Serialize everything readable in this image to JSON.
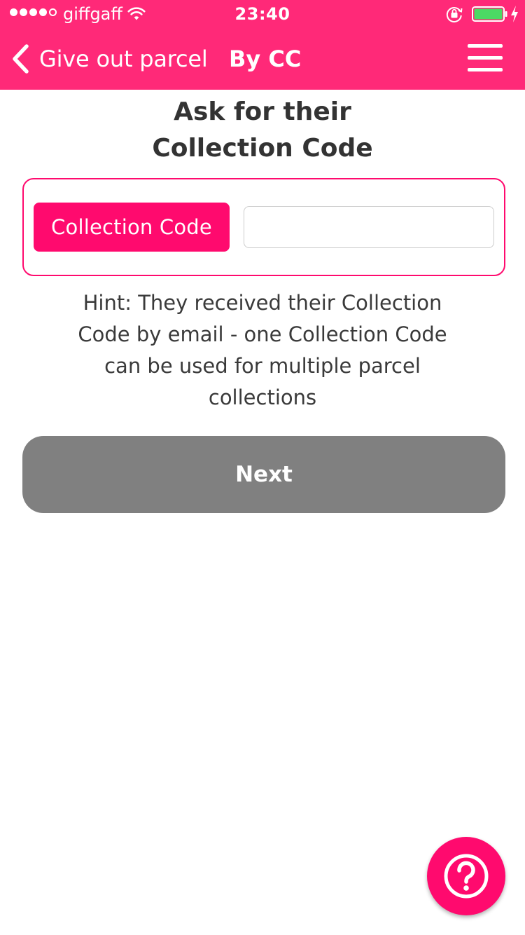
{
  "status_bar": {
    "carrier": "giffgaff",
    "time": "23:40",
    "signal_bars_filled": 4,
    "signal_bars_total": 5,
    "battery_level": 0.9,
    "icons": [
      "wifi-icon",
      "rotation-lock-icon",
      "battery-icon",
      "charging-icon"
    ]
  },
  "nav": {
    "back_label": "Give out parcel",
    "title": "By CC",
    "back_icon": "chevron-left-icon",
    "menu_icon": "hamburger-menu-icon"
  },
  "page": {
    "title_line1": "Ask for their",
    "title_line2": "Collection Code"
  },
  "code_field": {
    "label": "Collection Code",
    "value": "",
    "placeholder": ""
  },
  "hint": "Hint: They received their Collection Code by email - one Collection Code can be used for multiple parcel collections",
  "next_button": {
    "label": "Next",
    "enabled": false
  },
  "help_button": {
    "icon": "question-circle-icon"
  },
  "colors": {
    "brand": "#ff2978",
    "accent": "#ff0a6e",
    "disabled_button": "#808080",
    "text": "#3a3a3a"
  }
}
